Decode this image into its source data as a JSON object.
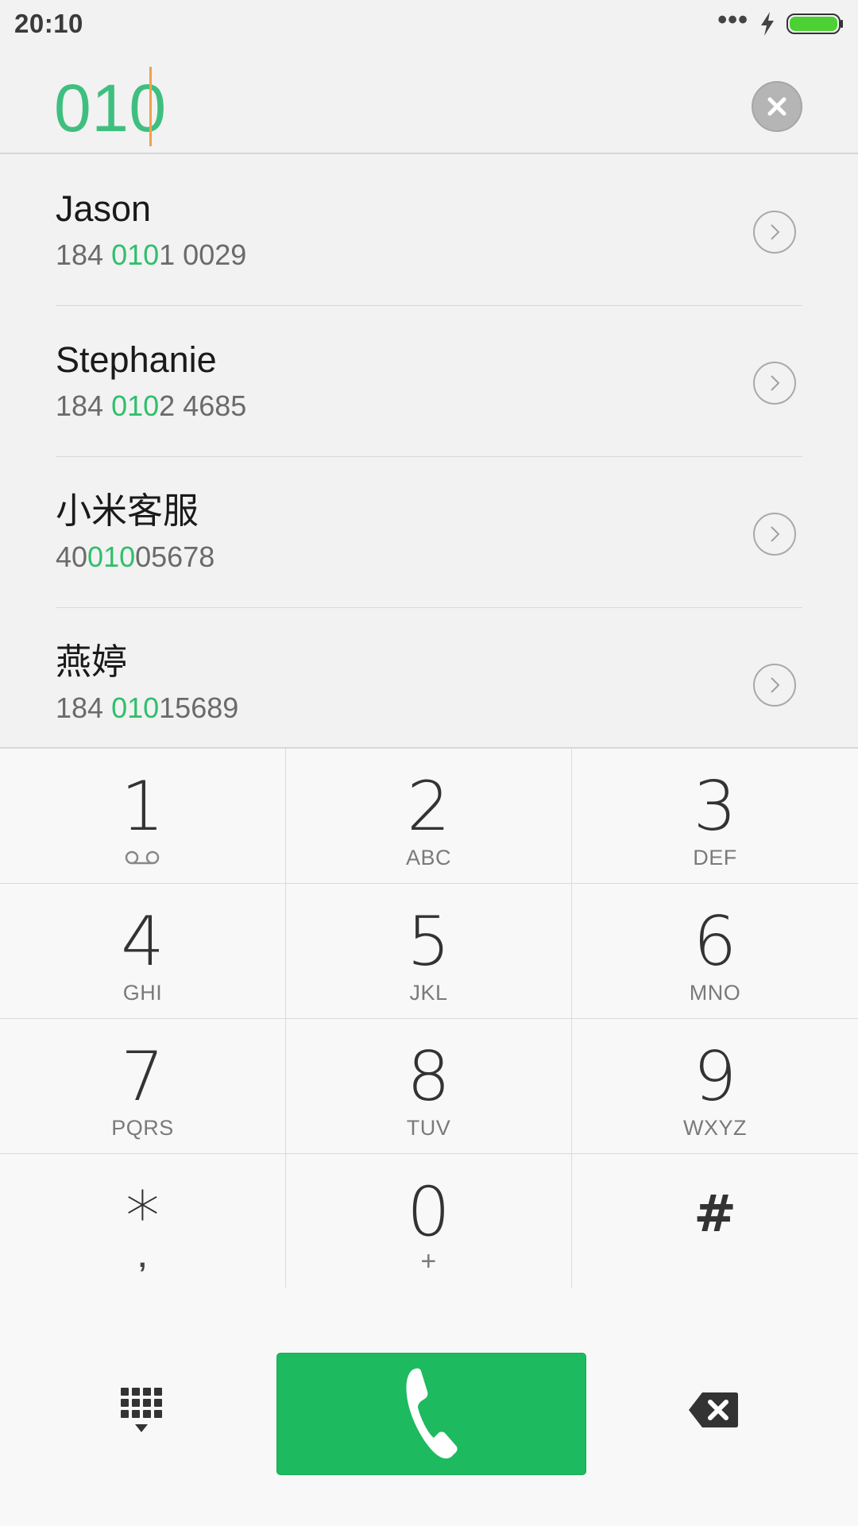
{
  "status_bar": {
    "time": "20:10",
    "dots": "•••"
  },
  "dialer": {
    "input_value": "010"
  },
  "contacts": [
    {
      "name": "Jason",
      "number_before": "184 ",
      "number_match": "010",
      "number_after": "1 0029"
    },
    {
      "name": "Stephanie",
      "number_before": "184 ",
      "number_match": "010",
      "number_after": "2 4685"
    },
    {
      "name": "小米客服",
      "number_before": "40",
      "number_match": "010",
      "number_after": "05678"
    },
    {
      "name": "燕婷",
      "number_before": "184 ",
      "number_match": "010",
      "number_after": "15689"
    }
  ],
  "keypad": [
    {
      "digit": "1",
      "letters": ""
    },
    {
      "digit": "2",
      "letters": "ABC"
    },
    {
      "digit": "3",
      "letters": "DEF"
    },
    {
      "digit": "4",
      "letters": "GHI"
    },
    {
      "digit": "5",
      "letters": "JKL"
    },
    {
      "digit": "6",
      "letters": "MNO"
    },
    {
      "digit": "7",
      "letters": "PQRS"
    },
    {
      "digit": "8",
      "letters": "TUV"
    },
    {
      "digit": "9",
      "letters": "WXYZ"
    },
    {
      "digit": "*",
      "letters": ","
    },
    {
      "digit": "0",
      "letters": "+"
    },
    {
      "digit": "#",
      "letters": ""
    }
  ],
  "icons": {
    "clear": "clear-circle-icon",
    "detail": "chevron-right-circle-icon",
    "voicemail": "voicemail-icon",
    "dialpad": "dialpad-icon",
    "call": "phone-handset-icon",
    "backspace": "backspace-icon",
    "charging": "lightning-bolt-icon",
    "battery": "battery-icon"
  },
  "colors": {
    "accent": "#3fbf7f",
    "match_highlight": "#2fbf6c",
    "call_button": "#1dba5f",
    "battery": "#4cd034",
    "cursor": "#f0a04b"
  }
}
